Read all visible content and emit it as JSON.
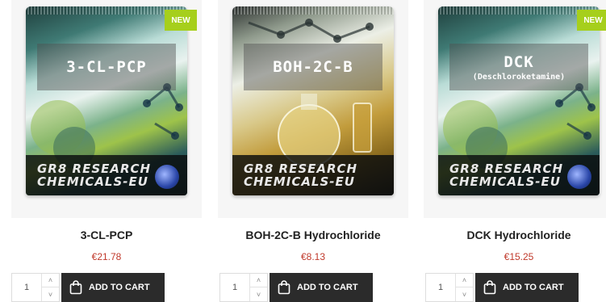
{
  "badge_label": "NEW",
  "brand_line1": "GR8 RESEARCH",
  "brand_line2": "CHEMICALS-EU",
  "cart_label": "ADD TO CART",
  "accent_color": "#a6cf1c",
  "price_color": "#c0392b",
  "products": [
    {
      "pack_title": "3-CL-PCP",
      "pack_subtitle": "",
      "name": "3-CL-PCP",
      "price": "€21.78",
      "qty": "1",
      "is_new": true
    },
    {
      "pack_title": "BOH-2C-B",
      "pack_subtitle": "",
      "name": "BOH-2C-B Hydrochloride",
      "price": "€8.13",
      "qty": "1",
      "is_new": false
    },
    {
      "pack_title": "DCK",
      "pack_subtitle": "(Deschloroketamine)",
      "name": "DCK Hydrochloride",
      "price": "€15.25",
      "qty": "1",
      "is_new": true
    }
  ],
  "icons": {
    "qty_up": "chevron-up-icon",
    "qty_down": "chevron-down-icon",
    "cart": "shopping-bag-icon"
  }
}
